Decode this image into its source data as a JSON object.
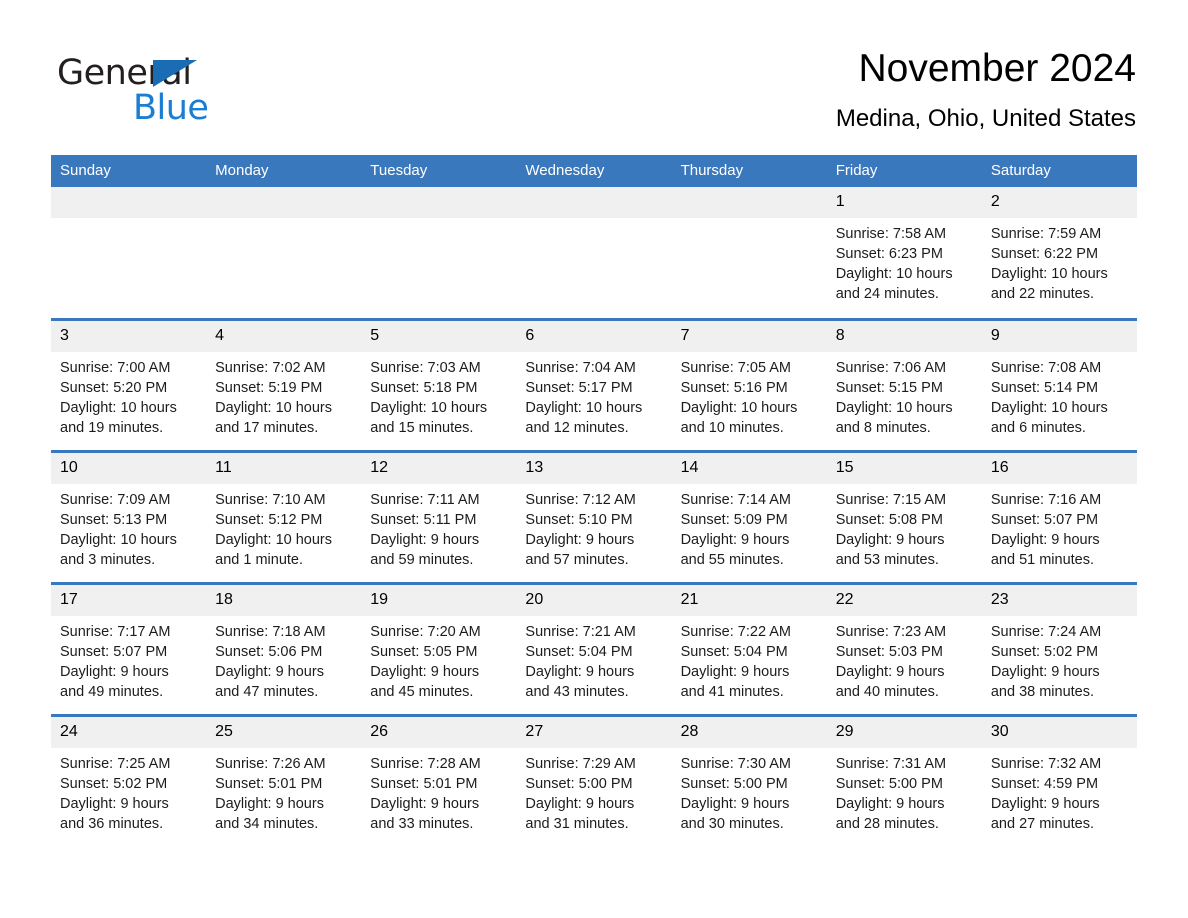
{
  "brand": {
    "name_part1": "General",
    "name_part2": "Blue"
  },
  "header": {
    "month_title": "November 2024",
    "location": "Medina, Ohio, United States"
  },
  "colors": {
    "header_blue": "#3a78bd",
    "logo_blue": "#1a7fd4",
    "daynum_band": "#f0f0f0"
  },
  "weekday_headers": [
    "Sunday",
    "Monday",
    "Tuesday",
    "Wednesday",
    "Thursday",
    "Friday",
    "Saturday"
  ],
  "weeks": [
    [
      {
        "day": "",
        "sunrise": "",
        "sunset": "",
        "daylight1": "",
        "daylight2": ""
      },
      {
        "day": "",
        "sunrise": "",
        "sunset": "",
        "daylight1": "",
        "daylight2": ""
      },
      {
        "day": "",
        "sunrise": "",
        "sunset": "",
        "daylight1": "",
        "daylight2": ""
      },
      {
        "day": "",
        "sunrise": "",
        "sunset": "",
        "daylight1": "",
        "daylight2": ""
      },
      {
        "day": "",
        "sunrise": "",
        "sunset": "",
        "daylight1": "",
        "daylight2": ""
      },
      {
        "day": "1",
        "sunrise": "Sunrise: 7:58 AM",
        "sunset": "Sunset: 6:23 PM",
        "daylight1": "Daylight: 10 hours",
        "daylight2": "and 24 minutes."
      },
      {
        "day": "2",
        "sunrise": "Sunrise: 7:59 AM",
        "sunset": "Sunset: 6:22 PM",
        "daylight1": "Daylight: 10 hours",
        "daylight2": "and 22 minutes."
      }
    ],
    [
      {
        "day": "3",
        "sunrise": "Sunrise: 7:00 AM",
        "sunset": "Sunset: 5:20 PM",
        "daylight1": "Daylight: 10 hours",
        "daylight2": "and 19 minutes."
      },
      {
        "day": "4",
        "sunrise": "Sunrise: 7:02 AM",
        "sunset": "Sunset: 5:19 PM",
        "daylight1": "Daylight: 10 hours",
        "daylight2": "and 17 minutes."
      },
      {
        "day": "5",
        "sunrise": "Sunrise: 7:03 AM",
        "sunset": "Sunset: 5:18 PM",
        "daylight1": "Daylight: 10 hours",
        "daylight2": "and 15 minutes."
      },
      {
        "day": "6",
        "sunrise": "Sunrise: 7:04 AM",
        "sunset": "Sunset: 5:17 PM",
        "daylight1": "Daylight: 10 hours",
        "daylight2": "and 12 minutes."
      },
      {
        "day": "7",
        "sunrise": "Sunrise: 7:05 AM",
        "sunset": "Sunset: 5:16 PM",
        "daylight1": "Daylight: 10 hours",
        "daylight2": "and 10 minutes."
      },
      {
        "day": "8",
        "sunrise": "Sunrise: 7:06 AM",
        "sunset": "Sunset: 5:15 PM",
        "daylight1": "Daylight: 10 hours",
        "daylight2": "and 8 minutes."
      },
      {
        "day": "9",
        "sunrise": "Sunrise: 7:08 AM",
        "sunset": "Sunset: 5:14 PM",
        "daylight1": "Daylight: 10 hours",
        "daylight2": "and 6 minutes."
      }
    ],
    [
      {
        "day": "10",
        "sunrise": "Sunrise: 7:09 AM",
        "sunset": "Sunset: 5:13 PM",
        "daylight1": "Daylight: 10 hours",
        "daylight2": "and 3 minutes."
      },
      {
        "day": "11",
        "sunrise": "Sunrise: 7:10 AM",
        "sunset": "Sunset: 5:12 PM",
        "daylight1": "Daylight: 10 hours",
        "daylight2": "and 1 minute."
      },
      {
        "day": "12",
        "sunrise": "Sunrise: 7:11 AM",
        "sunset": "Sunset: 5:11 PM",
        "daylight1": "Daylight: 9 hours",
        "daylight2": "and 59 minutes."
      },
      {
        "day": "13",
        "sunrise": "Sunrise: 7:12 AM",
        "sunset": "Sunset: 5:10 PM",
        "daylight1": "Daylight: 9 hours",
        "daylight2": "and 57 minutes."
      },
      {
        "day": "14",
        "sunrise": "Sunrise: 7:14 AM",
        "sunset": "Sunset: 5:09 PM",
        "daylight1": "Daylight: 9 hours",
        "daylight2": "and 55 minutes."
      },
      {
        "day": "15",
        "sunrise": "Sunrise: 7:15 AM",
        "sunset": "Sunset: 5:08 PM",
        "daylight1": "Daylight: 9 hours",
        "daylight2": "and 53 minutes."
      },
      {
        "day": "16",
        "sunrise": "Sunrise: 7:16 AM",
        "sunset": "Sunset: 5:07 PM",
        "daylight1": "Daylight: 9 hours",
        "daylight2": "and 51 minutes."
      }
    ],
    [
      {
        "day": "17",
        "sunrise": "Sunrise: 7:17 AM",
        "sunset": "Sunset: 5:07 PM",
        "daylight1": "Daylight: 9 hours",
        "daylight2": "and 49 minutes."
      },
      {
        "day": "18",
        "sunrise": "Sunrise: 7:18 AM",
        "sunset": "Sunset: 5:06 PM",
        "daylight1": "Daylight: 9 hours",
        "daylight2": "and 47 minutes."
      },
      {
        "day": "19",
        "sunrise": "Sunrise: 7:20 AM",
        "sunset": "Sunset: 5:05 PM",
        "daylight1": "Daylight: 9 hours",
        "daylight2": "and 45 minutes."
      },
      {
        "day": "20",
        "sunrise": "Sunrise: 7:21 AM",
        "sunset": "Sunset: 5:04 PM",
        "daylight1": "Daylight: 9 hours",
        "daylight2": "and 43 minutes."
      },
      {
        "day": "21",
        "sunrise": "Sunrise: 7:22 AM",
        "sunset": "Sunset: 5:04 PM",
        "daylight1": "Daylight: 9 hours",
        "daylight2": "and 41 minutes."
      },
      {
        "day": "22",
        "sunrise": "Sunrise: 7:23 AM",
        "sunset": "Sunset: 5:03 PM",
        "daylight1": "Daylight: 9 hours",
        "daylight2": "and 40 minutes."
      },
      {
        "day": "23",
        "sunrise": "Sunrise: 7:24 AM",
        "sunset": "Sunset: 5:02 PM",
        "daylight1": "Daylight: 9 hours",
        "daylight2": "and 38 minutes."
      }
    ],
    [
      {
        "day": "24",
        "sunrise": "Sunrise: 7:25 AM",
        "sunset": "Sunset: 5:02 PM",
        "daylight1": "Daylight: 9 hours",
        "daylight2": "and 36 minutes."
      },
      {
        "day": "25",
        "sunrise": "Sunrise: 7:26 AM",
        "sunset": "Sunset: 5:01 PM",
        "daylight1": "Daylight: 9 hours",
        "daylight2": "and 34 minutes."
      },
      {
        "day": "26",
        "sunrise": "Sunrise: 7:28 AM",
        "sunset": "Sunset: 5:01 PM",
        "daylight1": "Daylight: 9 hours",
        "daylight2": "and 33 minutes."
      },
      {
        "day": "27",
        "sunrise": "Sunrise: 7:29 AM",
        "sunset": "Sunset: 5:00 PM",
        "daylight1": "Daylight: 9 hours",
        "daylight2": "and 31 minutes."
      },
      {
        "day": "28",
        "sunrise": "Sunrise: 7:30 AM",
        "sunset": "Sunset: 5:00 PM",
        "daylight1": "Daylight: 9 hours",
        "daylight2": "and 30 minutes."
      },
      {
        "day": "29",
        "sunrise": "Sunrise: 7:31 AM",
        "sunset": "Sunset: 5:00 PM",
        "daylight1": "Daylight: 9 hours",
        "daylight2": "and 28 minutes."
      },
      {
        "day": "30",
        "sunrise": "Sunrise: 7:32 AM",
        "sunset": "Sunset: 4:59 PM",
        "daylight1": "Daylight: 9 hours",
        "daylight2": "and 27 minutes."
      }
    ]
  ]
}
